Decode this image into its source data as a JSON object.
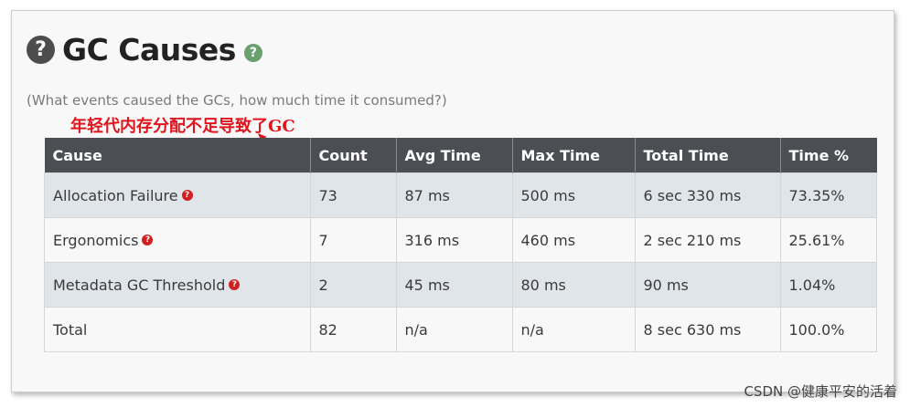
{
  "header": {
    "help_glyph": "?",
    "title": "GC Causes",
    "subtitle": "(What events caused the GCs, how much time it consumed?)"
  },
  "annotation": {
    "text": "年轻代内存分配不足导致了GC",
    "color": "#e0141c"
  },
  "table": {
    "columns": [
      "Cause",
      "Count",
      "Avg Time",
      "Max Time",
      "Total Time",
      "Time %"
    ],
    "rows": [
      {
        "cause": "Allocation Failure",
        "count": "73",
        "avg_time": "87 ms",
        "max_time": "500 ms",
        "total_time": "6 sec 330 ms",
        "time_pct": "73.35%"
      },
      {
        "cause": "Ergonomics",
        "count": "7",
        "avg_time": "316 ms",
        "max_time": "460 ms",
        "total_time": "2 sec 210 ms",
        "time_pct": "25.61%"
      },
      {
        "cause": "Metadata GC Threshold",
        "count": "2",
        "avg_time": "45 ms",
        "max_time": "80 ms",
        "total_time": "90 ms",
        "time_pct": "1.04%"
      },
      {
        "cause": "Total",
        "count": "82",
        "avg_time": "n/a",
        "max_time": "n/a",
        "total_time": "8 sec 630 ms",
        "time_pct": "100.0%"
      }
    ]
  },
  "watermark": "CSDN @健康平安的活着",
  "colors": {
    "header_bg": "#4b4f54",
    "row_alt_bg": "#e0e5ea",
    "help_green": "#6a9f6e",
    "help_red": "#d21f1f"
  }
}
